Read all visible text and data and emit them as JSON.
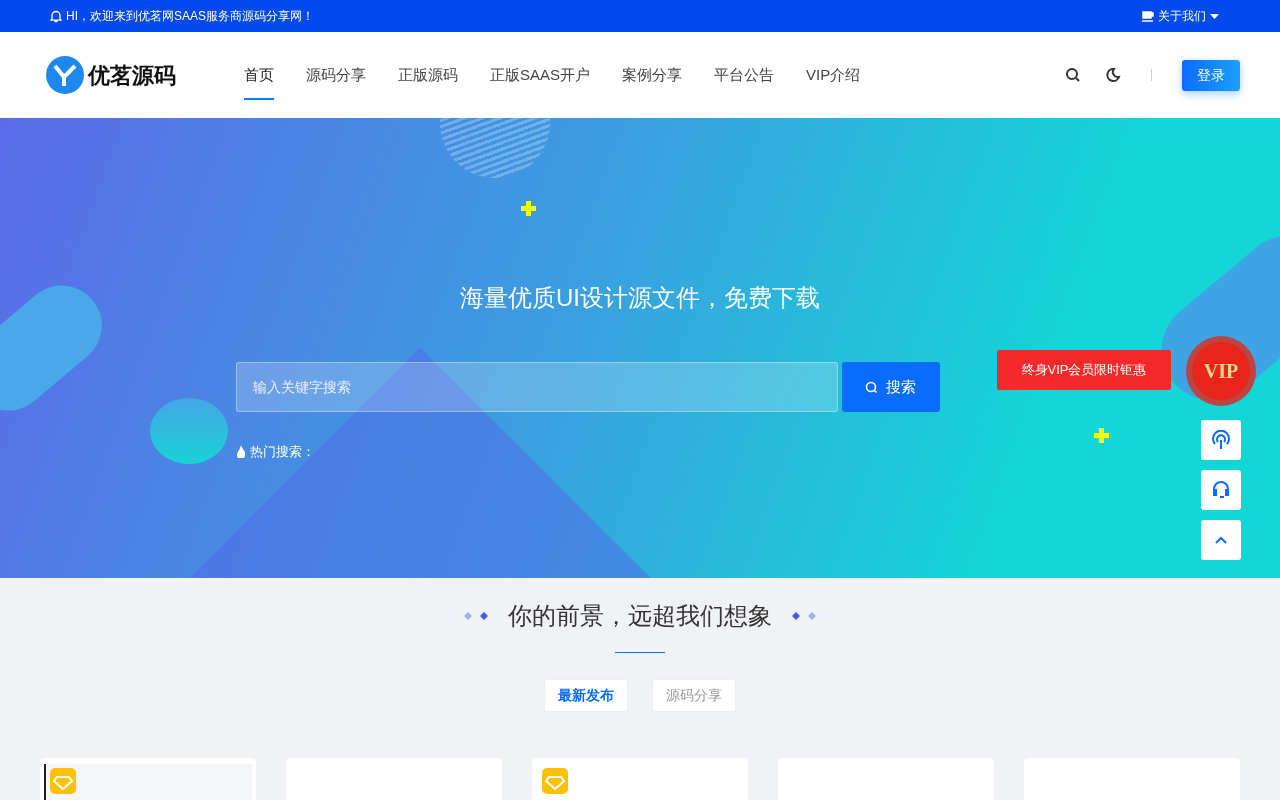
{
  "top_bar": {
    "notice": "HI，欢迎来到优茗网SAAS服务商源码分享网！",
    "about": "关于我们"
  },
  "header": {
    "logo_text": "优茗源码",
    "login": "登录",
    "nav": [
      {
        "label": "首页",
        "selected": true
      },
      {
        "label": "源码分享",
        "selected": false
      },
      {
        "label": "正版源码",
        "selected": false
      },
      {
        "label": "正版SAAS开户",
        "selected": false
      },
      {
        "label": "案例分享",
        "selected": false
      },
      {
        "label": "平台公告",
        "selected": false
      },
      {
        "label": "VIP介绍",
        "selected": false
      }
    ]
  },
  "hero": {
    "title": "海量优质UI设计源文件，免费下载",
    "search": {
      "placeholder": "输入关键字搜索",
      "button": "搜索"
    },
    "hot_label": "热门搜索："
  },
  "float": {
    "promo": "终身VIP会员限时钜惠",
    "vip_badge": "VIP"
  },
  "section": {
    "title": "你的前景，远超我们想象",
    "tabs": [
      {
        "label": "最新发布",
        "selected": true
      },
      {
        "label": "源码分享",
        "selected": false
      }
    ]
  },
  "cards": [
    {
      "kind": "thumbnail",
      "vip": true
    },
    {
      "kind": "blank",
      "vip": false
    },
    {
      "kind": "blank",
      "vip": true
    },
    {
      "kind": "blank",
      "vip": false
    },
    {
      "kind": "blank",
      "vip": false
    }
  ]
}
